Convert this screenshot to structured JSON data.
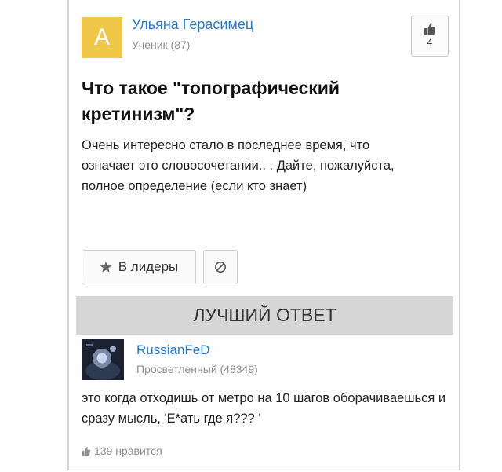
{
  "question": {
    "author": {
      "avatar_letter": "A",
      "name": "Ульяна Герасимец",
      "rank": "Ученик (87)"
    },
    "like_count": "4",
    "title": "Что такое \"топографический кретинизм\"?",
    "body": "Очень интересно стало в последнее время, что означает это словосочетании.. . Дайте, пожалуйста, полное определение (если кто знает)",
    "leaders_button": "В лидеры"
  },
  "best_answer": {
    "header": "ЛУЧШИЙ ОТВЕТ",
    "author": {
      "name": "RussianFeD",
      "rank": "Просветленный (48349)"
    },
    "text": "это когда отходишь от метро на 10 шагов оборачиваешься и сразу мысль, 'Е*ать где я??? '",
    "likes": "139 нравится"
  },
  "colors": {
    "accent_link": "#2a7ac8",
    "avatar_bg": "#f1c74a",
    "best_bar_bg": "#d6d6d6"
  },
  "icons": [
    "thumbs-up-icon",
    "star-icon",
    "block-icon"
  ]
}
